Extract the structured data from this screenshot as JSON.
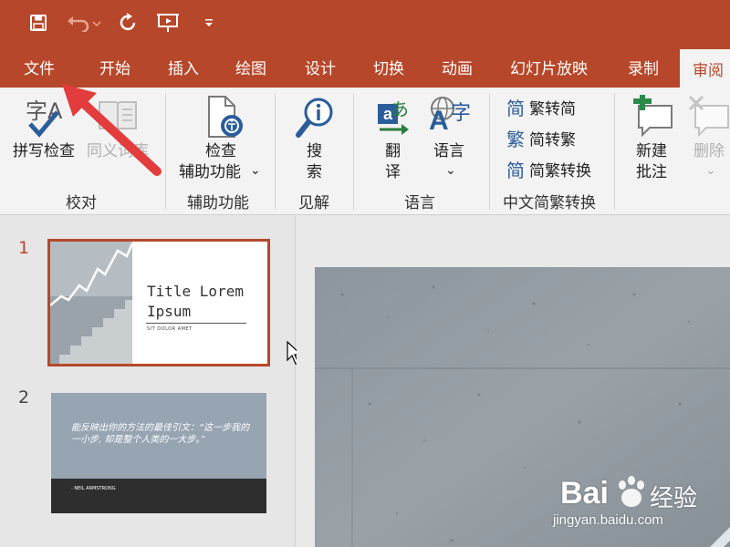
{
  "quick_access": {
    "save_icon": "save-icon",
    "undo_icon": "undo-icon",
    "redo_icon": "repeat-icon",
    "present_icon": "start-from-beginning-icon",
    "customize_icon": "customize-qat-icon"
  },
  "tabs": [
    "文件",
    "开始",
    "插入",
    "绘图",
    "设计",
    "切换",
    "动画",
    "幻灯片放映",
    "录制",
    "审阅"
  ],
  "active_tab": "审阅",
  "ribbon": {
    "proofing": {
      "spelling_icon_letters": "字A",
      "spelling_label": "拼写检查",
      "thesaurus_label": "同义词库",
      "group_label": "校对"
    },
    "accessibility": {
      "check_label_line1": "检查",
      "check_label_line2": "辅助功能",
      "dropdown_glyph": "⌄",
      "group_label": "辅助功能"
    },
    "insights": {
      "search_label_line1": "搜",
      "search_label_line2": "索",
      "group_label": "见解"
    },
    "language": {
      "translate_icon_text": "あ",
      "translate_label_line1": "翻",
      "translate_label_line2": "译",
      "language_icon_text": "字",
      "language_label": "语言",
      "dropdown_glyph": "⌄",
      "group_label": "语言"
    },
    "chinese_conversion": {
      "items": [
        {
          "glyph": "简",
          "label": "繁转简"
        },
        {
          "glyph": "繁",
          "label": "简转繁"
        },
        {
          "glyph": "简",
          "label": "简繁转换"
        }
      ],
      "group_label": "中文简繁转换"
    },
    "comments": {
      "new_comment_line1": "新建",
      "new_comment_line2": "批注",
      "delete_label": "删除",
      "dropdown_glyph": "⌄"
    }
  },
  "slides": {
    "slide1": {
      "number": "1",
      "title_line1": "Title Lorem",
      "title_line2": "Ipsum",
      "subtitle": "SIT DOLOR AMET"
    },
    "slide2": {
      "number": "2",
      "quote": "能反映出你的方法的最佳引文：“这一步我的一小步, 却是整个人类的一大步。”",
      "author": "- NEIL ARMSTRONG"
    }
  },
  "watermark": {
    "brand_left": "Bai",
    "brand_right": "经验",
    "url": "jingyan.baidu.com"
  },
  "colors": {
    "accent": "#b7472a",
    "ribbon_bg": "#f3f3f3",
    "annotation_arrow": "#e33c3c"
  }
}
